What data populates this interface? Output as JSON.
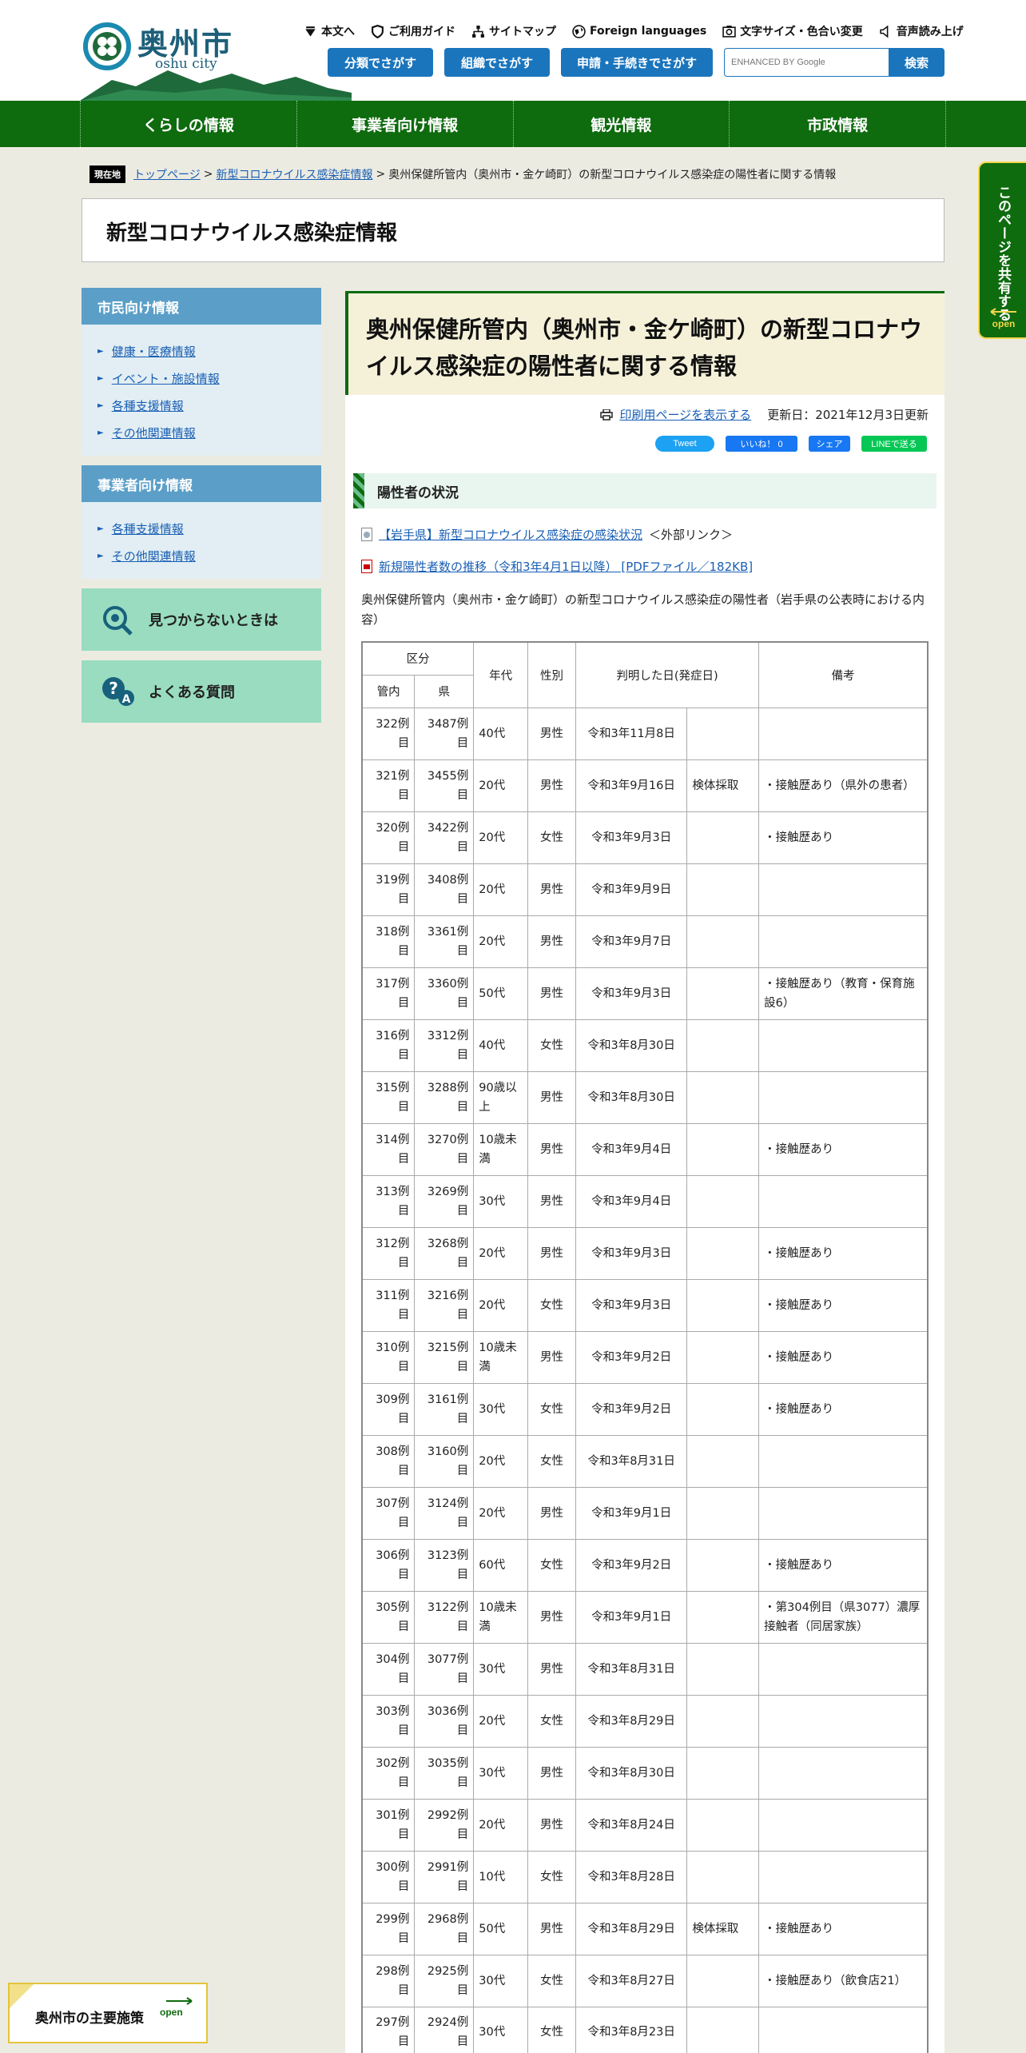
{
  "header": {
    "site_name": "奥州市",
    "site_name_en": "oshu city",
    "utility_links": [
      {
        "label": "本文へ",
        "icon": "skip-down-icon"
      },
      {
        "label": "ご利用ガイド",
        "icon": "shield-guide-icon"
      },
      {
        "label": "サイトマップ",
        "icon": "sitemap-icon"
      },
      {
        "label": "Foreign languages",
        "icon": "globe-icon"
      },
      {
        "label": "文字サイズ・色合い変更",
        "icon": "font-size-icon"
      },
      {
        "label": "音声読み上げ",
        "icon": "speaker-icon"
      }
    ],
    "buttons": {
      "bunya": "分類でさがす",
      "soshiki": "組織でさがす",
      "shinsei": "申請・手続きでさがす"
    },
    "search": {
      "placeholder": "ENHANCED BY Google",
      "button": "検索"
    },
    "accent_color": "#0e6b0e",
    "button_color": "#1b75bc"
  },
  "global_nav": [
    "くらしの情報",
    "事業者向け情報",
    "観光情報",
    "市政情報"
  ],
  "breadcrumb": {
    "label": "現在地",
    "items": [
      "トップページ",
      "新型コロナウイルス感染症情報"
    ],
    "current": "奥州保健所管内（奥州市・金ケ崎町）の新型コロナウイルス感染症の陽性者に関する情報"
  },
  "category_title": "新型コロナウイルス感染症情報",
  "sidebar": {
    "citizen": {
      "title": "市民向け情報",
      "items": [
        "健康・医療情報",
        "イベント・施設情報",
        "各種支援情報",
        "その他関連情報"
      ]
    },
    "business": {
      "title": "事業者向け情報",
      "items": [
        "各種支援情報",
        "その他関連情報"
      ]
    },
    "not_found": "見つからないときは",
    "faq": "よくある質問"
  },
  "page": {
    "title": "奥州保健所管内（奥州市・金ケ崎町）の新型コロナウイルス感染症の陽性者に関する情報",
    "print_link": "印刷用ページを表示する",
    "updated": "更新日：2021年12月3日更新",
    "share": {
      "tweet": "Tweet",
      "like": "いいね！ 0",
      "share": "シェア",
      "line": "LINEで送る"
    },
    "section_title": "陽性者の状況",
    "link1": "【岩手県】新型コロナウイルス感染症の感染状況",
    "link1_suffix": "＜外部リンク＞",
    "link2": "新規陽性者数の推移（令和3年4月1日以降） [PDFファイル／182KB]",
    "intro": "奥州保健所管内（奥州市・金ケ崎町）の新型コロナウイルス感染症の陽性者（岩手県の公表時における内容）"
  },
  "table": {
    "headers": {
      "kubun": "区分",
      "kannai": "管内",
      "ken": "県",
      "age": "年代",
      "sex": "性別",
      "date": "判明した日(発症日)",
      "note": "備考"
    },
    "rows": [
      [
        "322例目",
        "3487例目",
        "40代",
        "男性",
        "令和3年11月8日",
        "",
        ""
      ],
      [
        "321例目",
        "3455例目",
        "20代",
        "男性",
        "令和3年9月16日",
        "検体採取",
        "・接触歴あり（県外の患者）"
      ],
      [
        "320例目",
        "3422例目",
        "20代",
        "女性",
        "令和3年9月3日",
        "",
        "・接触歴あり"
      ],
      [
        "319例目",
        "3408例目",
        "20代",
        "男性",
        "令和3年9月9日",
        "",
        ""
      ],
      [
        "318例目",
        "3361例目",
        "20代",
        "男性",
        "令和3年9月7日",
        "",
        ""
      ],
      [
        "317例目",
        "3360例目",
        "50代",
        "男性",
        "令和3年9月3日",
        "",
        "・接触歴あり（教育・保育施設6）"
      ],
      [
        "316例目",
        "3312例目",
        "40代",
        "女性",
        "令和3年8月30日",
        "",
        ""
      ],
      [
        "315例目",
        "3288例目",
        "90歳以上",
        "男性",
        "令和3年8月30日",
        "",
        ""
      ],
      [
        "314例目",
        "3270例目",
        "10歳未満",
        "男性",
        "令和3年9月4日",
        "",
        "・接触歴あり"
      ],
      [
        "313例目",
        "3269例目",
        "30代",
        "男性",
        "令和3年9月4日",
        "",
        ""
      ],
      [
        "312例目",
        "3268例目",
        "20代",
        "男性",
        "令和3年9月3日",
        "",
        "・接触歴あり"
      ],
      [
        "311例目",
        "3216例目",
        "20代",
        "女性",
        "令和3年9月3日",
        "",
        "・接触歴あり"
      ],
      [
        "310例目",
        "3215例目",
        "10歳未満",
        "男性",
        "令和3年9月2日",
        "",
        "・接触歴あり"
      ],
      [
        "309例目",
        "3161例目",
        "30代",
        "女性",
        "令和3年9月2日",
        "",
        "・接触歴あり"
      ],
      [
        "308例目",
        "3160例目",
        "20代",
        "女性",
        "令和3年8月31日",
        "",
        ""
      ],
      [
        "307例目",
        "3124例目",
        "20代",
        "男性",
        "令和3年9月1日",
        "",
        ""
      ],
      [
        "306例目",
        "3123例目",
        "60代",
        "女性",
        "令和3年9月2日",
        "",
        "・接触歴あり"
      ],
      [
        "305例目",
        "3122例目",
        "10歳未満",
        "男性",
        "令和3年9月1日",
        "",
        "・第304例目（県3077）濃厚接触者（同居家族）"
      ],
      [
        "304例目",
        "3077例目",
        "30代",
        "男性",
        "令和3年8月31日",
        "",
        ""
      ],
      [
        "303例目",
        "3036例目",
        "20代",
        "女性",
        "令和3年8月29日",
        "",
        ""
      ],
      [
        "302例目",
        "3035例目",
        "30代",
        "男性",
        "令和3年8月30日",
        "",
        ""
      ],
      [
        "301例目",
        "2992例目",
        "20代",
        "男性",
        "令和3年8月24日",
        "",
        ""
      ],
      [
        "300例目",
        "2991例目",
        "10代",
        "女性",
        "令和3年8月28日",
        "",
        ""
      ],
      [
        "299例目",
        "2968例目",
        "50代",
        "男性",
        "令和3年8月29日",
        "検体採取",
        "・接触歴あり"
      ],
      [
        "298例目",
        "2925例目",
        "30代",
        "女性",
        "令和3年8月27日",
        "",
        "・接触歴あり（飲食店21）"
      ],
      [
        "297例目",
        "2924例目",
        "30代",
        "女性",
        "令和3年8月23日",
        "",
        ""
      ]
    ]
  },
  "side_tab": {
    "label": "このページを共有する",
    "open": "open"
  },
  "policy_tab": {
    "label": "奥州市の主要施策",
    "open": "open"
  }
}
